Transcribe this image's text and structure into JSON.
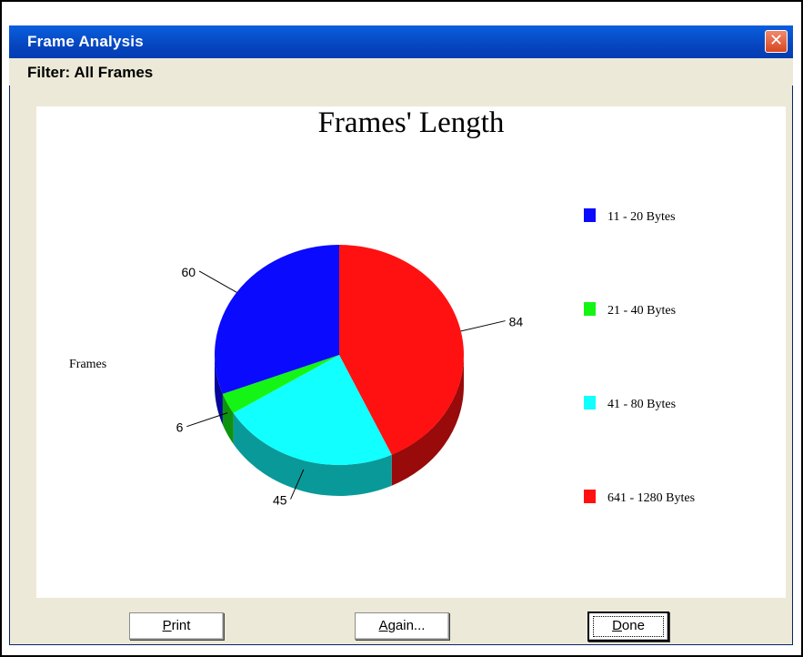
{
  "window": {
    "title": "Frame Analysis",
    "close_glyph": "✕",
    "filter": "Filter: All Frames"
  },
  "buttons": {
    "print": {
      "mnemonic": "P",
      "rest": "rint"
    },
    "again": {
      "mnemonic": "A",
      "rest": "gain..."
    },
    "done": {
      "mnemonic": "D",
      "rest": "one"
    }
  },
  "colors": {
    "blue": "#0a0aff",
    "green": "#15f515",
    "cyan": "#11ffff",
    "red": "#ff1111"
  },
  "chart_data": {
    "type": "pie",
    "title": "Frames' Length",
    "ylabel": "Frames",
    "legend_position": "right",
    "categories": [
      "11 - 20 Bytes",
      "21 - 40 Bytes",
      "41 - 80 Bytes",
      "641 - 1280 Bytes"
    ],
    "values": [
      60,
      6,
      45,
      84
    ],
    "colors": [
      "#0a0aff",
      "#15f515",
      "#11ffff",
      "#ff1111"
    ],
    "style": "3d"
  }
}
